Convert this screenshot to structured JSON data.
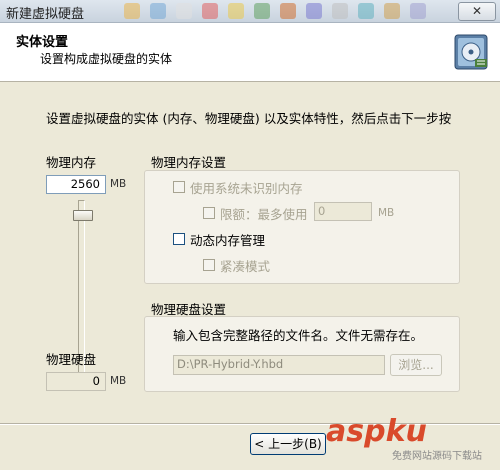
{
  "window": {
    "title": "新建虚拟硬盘",
    "close_label": "✕"
  },
  "header": {
    "title": "实体设置",
    "subtitle": "设置构成虚拟硬盘的实体"
  },
  "intro": "设置虚拟硬盘的实体 (内存、物理硬盘) 以及实体特性，然后点击下一步按",
  "left": {
    "ram_label": "物理内存",
    "ram_value": "2560",
    "ram_unit": "MB",
    "disk_label": "物理硬盘",
    "disk_value": "0",
    "disk_unit": "MB",
    "slider_level": 0.92
  },
  "memory_group": {
    "title": "物理内存设置",
    "use_unrecognized": "使用系统未识别内存",
    "limit_label": "限额：最多使用",
    "limit_value": "0",
    "limit_unit": "MB",
    "dynamic": "动态内存管理",
    "compact": "紧凑模式"
  },
  "disk_group": {
    "title": "物理硬盘设置",
    "note": "输入包含完整路径的文件名。文件无需存在。",
    "path_value": "D:\\PR-Hybrid-Y.hbd",
    "browse_label": "浏览..."
  },
  "buttons": {
    "back_label": "< 上一步(B)"
  },
  "watermark": {
    "brand": "aspku",
    "tagline": "免费网站源码下载站"
  }
}
